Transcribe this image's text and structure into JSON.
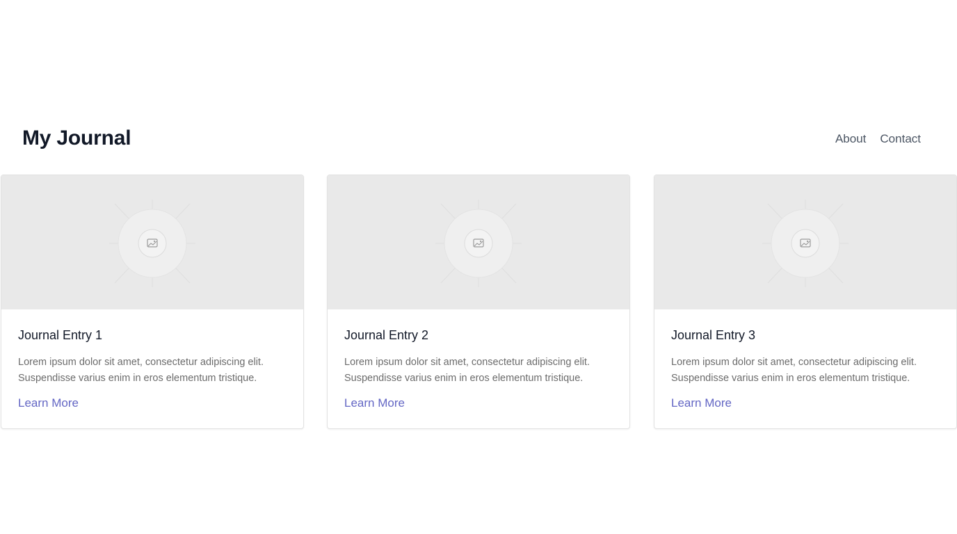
{
  "header": {
    "title": "My Journal",
    "nav": [
      "About",
      "Contact"
    ]
  },
  "cards": [
    {
      "title": "Journal Entry 1",
      "text": "Lorem ipsum dolor sit amet, consectetur adipiscing elit. Suspendisse varius enim in eros elementum tristique.",
      "link": "Learn More",
      "image_icon": "image-placeholder-icon"
    },
    {
      "title": "Journal Entry 2",
      "text": "Lorem ipsum dolor sit amet, consectetur adipiscing elit. Suspendisse varius enim in eros elementum tristique.",
      "link": "Learn More",
      "image_icon": "image-placeholder-icon"
    },
    {
      "title": "Journal Entry 3",
      "text": "Lorem ipsum dolor sit amet, consectetur adipiscing elit. Suspendisse varius enim in eros elementum tristique.",
      "link": "Learn More",
      "image_icon": "image-placeholder-icon"
    }
  ],
  "colors": {
    "title": "#111827",
    "nav": "#4b5563",
    "link": "#6366c4",
    "image_bg": "#e9e9e9"
  }
}
